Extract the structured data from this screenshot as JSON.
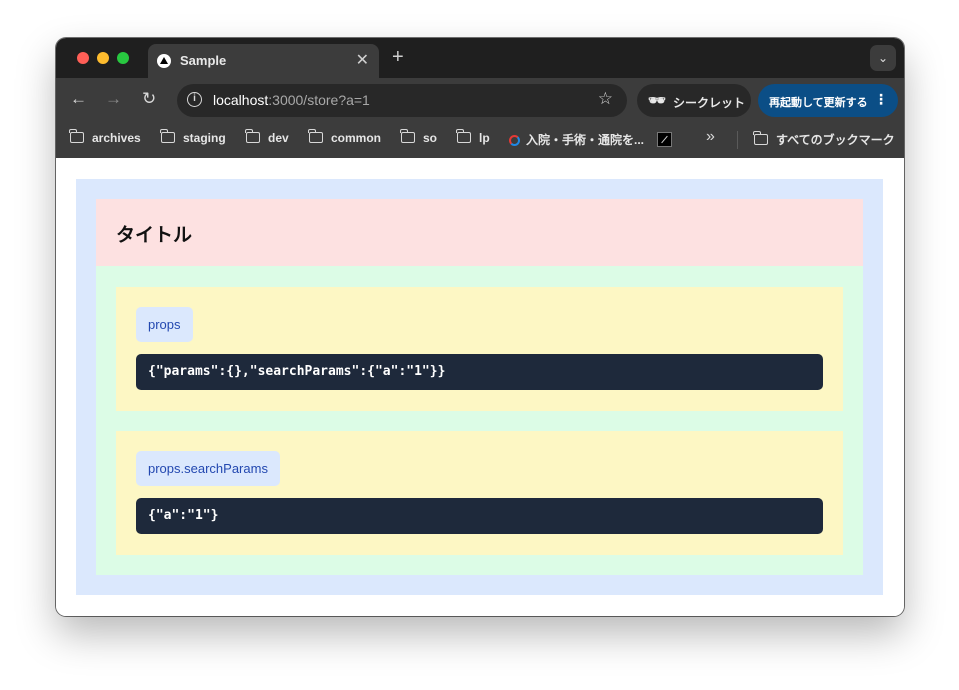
{
  "browser": {
    "tab_title": "Sample",
    "url_host": "localhost",
    "url_rest": ":3000/store?a=1",
    "incognito_label": "シークレット",
    "update_label": "再起動して更新する",
    "bookmarks": [
      "archives",
      "staging",
      "dev",
      "common",
      "so",
      "lp",
      "入院・手術・通院を...",
      "すべてのブックマーク"
    ]
  },
  "icons": {
    "close": "close-icon",
    "new_tab": "plus-icon",
    "back": "arrow-left-icon",
    "forward": "arrow-right-icon",
    "reload": "reload-icon",
    "info": "info-icon",
    "star": "star-icon",
    "incognito": "incognito-icon",
    "menu": "kebab-icon",
    "folder": "folder-icon",
    "overflow": "chevron-double-right-icon"
  },
  "page": {
    "title": "タイトル",
    "sections": [
      {
        "label": "props",
        "code": "{\"params\":{},\"searchParams\":{\"a\":\"1\"}}"
      },
      {
        "label": "props.searchParams",
        "code": "{\"a\":\"1\"}"
      }
    ]
  },
  "colors": {
    "outer_bg": "#dbe8fd",
    "header_bg": "#fde1e1",
    "content_bg": "#dcfce6",
    "card_bg": "#fdf7c4",
    "label_bg": "#dbe8fd",
    "label_text": "#2348b0",
    "code_bg": "#1e293b",
    "update_button": "#0b4e86"
  }
}
